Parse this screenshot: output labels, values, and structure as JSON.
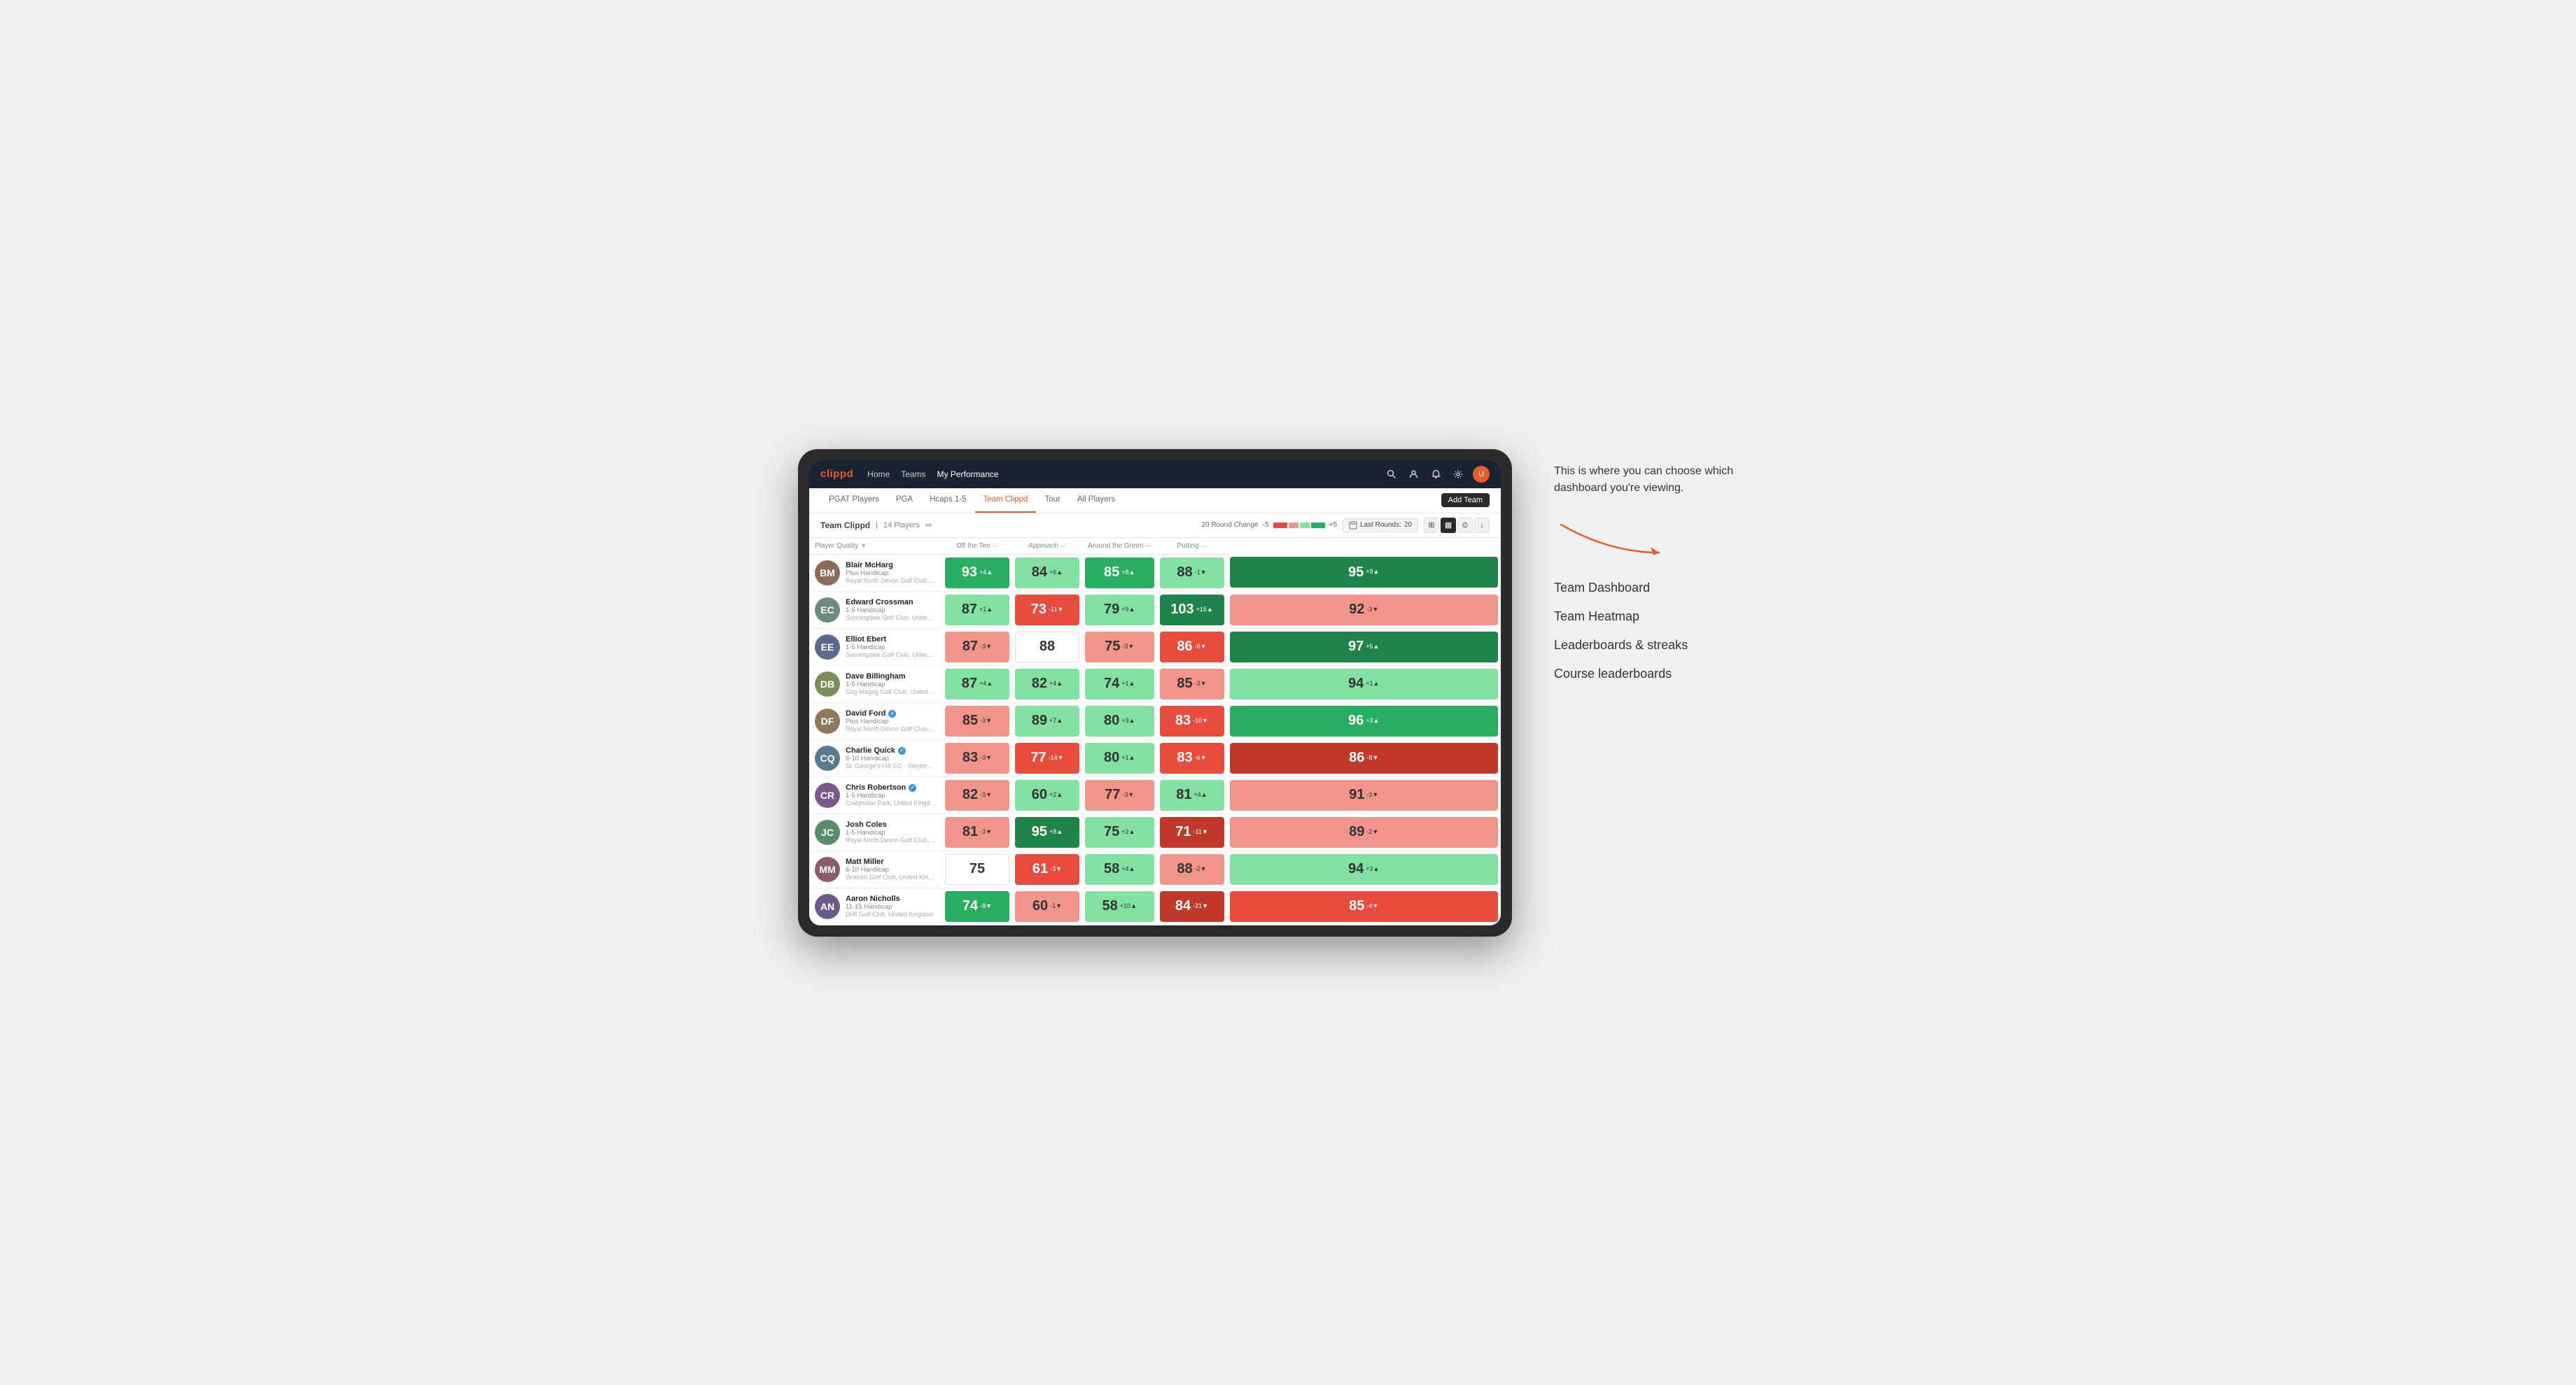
{
  "annotation": {
    "intro_text": "This is where you can choose which dashboard you're viewing.",
    "options": [
      {
        "label": "Team Dashboard"
      },
      {
        "label": "Team Heatmap"
      },
      {
        "label": "Leaderboards & streaks"
      },
      {
        "label": "Course leaderboards"
      }
    ]
  },
  "navbar": {
    "logo": "clippd",
    "links": [
      {
        "label": "Home",
        "active": false
      },
      {
        "label": "Teams",
        "active": false
      },
      {
        "label": "My Performance",
        "active": true
      }
    ],
    "icons": [
      "search",
      "user",
      "bell",
      "settings",
      "avatar"
    ]
  },
  "tabs": [
    {
      "label": "PGAT Players",
      "active": false
    },
    {
      "label": "PGA",
      "active": false
    },
    {
      "label": "Hcaps 1-5",
      "active": false
    },
    {
      "label": "Team Clippd",
      "active": true
    },
    {
      "label": "Tour",
      "active": false
    },
    {
      "label": "All Players",
      "active": false
    }
  ],
  "add_team_label": "Add Team",
  "sub_header": {
    "team_name": "Team Clippd",
    "player_count": "14 Players",
    "round_change_label": "20 Round Change",
    "change_min": "-5",
    "change_max": "+5",
    "last_rounds_label": "Last Rounds:",
    "last_rounds_value": "20"
  },
  "column_headers": [
    {
      "label": "Player Quality",
      "sortable": true,
      "key": "player_quality"
    },
    {
      "label": "Off the Tee",
      "sortable": true,
      "key": "off_tee"
    },
    {
      "label": "Approach",
      "sortable": true,
      "key": "approach"
    },
    {
      "label": "Around the Green",
      "sortable": true,
      "key": "around_green"
    },
    {
      "label": "Putting",
      "sortable": true,
      "key": "putting"
    }
  ],
  "players": [
    {
      "name": "Blair McHarg",
      "handicap": "Plus Handicap",
      "club": "Royal North Devon Golf Club, United Kingdom",
      "avatar_color": "#8e6a5a",
      "initials": "BM",
      "verified": false,
      "scores": [
        {
          "value": 93,
          "delta": "+4",
          "direction": "up",
          "color": "medium-green"
        },
        {
          "value": 84,
          "delta": "+6",
          "direction": "up",
          "color": "light-green"
        },
        {
          "value": 85,
          "delta": "+8",
          "direction": "up",
          "color": "medium-green"
        },
        {
          "value": 88,
          "delta": "-1",
          "direction": "down",
          "color": "light-green"
        },
        {
          "value": 95,
          "delta": "+9",
          "direction": "up",
          "color": "dark-green"
        }
      ]
    },
    {
      "name": "Edward Crossman",
      "handicap": "1-5 Handicap",
      "club": "Sunningdale Golf Club, United Kingdom",
      "avatar_color": "#6a8e7a",
      "initials": "EC",
      "verified": false,
      "scores": [
        {
          "value": 87,
          "delta": "+1",
          "direction": "up",
          "color": "light-green"
        },
        {
          "value": 73,
          "delta": "-11",
          "direction": "down",
          "color": "medium-red"
        },
        {
          "value": 79,
          "delta": "+9",
          "direction": "up",
          "color": "light-green"
        },
        {
          "value": 103,
          "delta": "+15",
          "direction": "up",
          "color": "dark-green"
        },
        {
          "value": 92,
          "delta": "-3",
          "direction": "down",
          "color": "light-red"
        }
      ]
    },
    {
      "name": "Elliot Ebert",
      "handicap": "1-5 Handicap",
      "club": "Sunningdale Golf Club, United Kingdom",
      "avatar_color": "#5a6a8e",
      "initials": "EE",
      "verified": false,
      "scores": [
        {
          "value": 87,
          "delta": "-3",
          "direction": "down",
          "color": "light-red"
        },
        {
          "value": 88,
          "delta": "",
          "direction": "none",
          "color": "white"
        },
        {
          "value": 75,
          "delta": "-3",
          "direction": "down",
          "color": "light-red"
        },
        {
          "value": 86,
          "delta": "-6",
          "direction": "down",
          "color": "medium-red"
        },
        {
          "value": 97,
          "delta": "+5",
          "direction": "up",
          "color": "dark-green"
        }
      ]
    },
    {
      "name": "Dave Billingham",
      "handicap": "1-5 Handicap",
      "club": "Gog Magog Golf Club, United Kingdom",
      "avatar_color": "#7a8e5a",
      "initials": "DB",
      "verified": false,
      "scores": [
        {
          "value": 87,
          "delta": "+4",
          "direction": "up",
          "color": "light-green"
        },
        {
          "value": 82,
          "delta": "+4",
          "direction": "up",
          "color": "light-green"
        },
        {
          "value": 74,
          "delta": "+1",
          "direction": "up",
          "color": "light-green"
        },
        {
          "value": 85,
          "delta": "-3",
          "direction": "down",
          "color": "light-red"
        },
        {
          "value": 94,
          "delta": "+1",
          "direction": "up",
          "color": "light-green"
        }
      ]
    },
    {
      "name": "David Ford",
      "handicap": "Plus Handicap",
      "club": "Royal North Devon Golf Club, United Kingdom",
      "avatar_color": "#8e7a5a",
      "initials": "DF",
      "verified": true,
      "scores": [
        {
          "value": 85,
          "delta": "-3",
          "direction": "down",
          "color": "light-red"
        },
        {
          "value": 89,
          "delta": "+7",
          "direction": "up",
          "color": "light-green"
        },
        {
          "value": 80,
          "delta": "+3",
          "direction": "up",
          "color": "light-green"
        },
        {
          "value": 83,
          "delta": "-10",
          "direction": "down",
          "color": "medium-red"
        },
        {
          "value": 96,
          "delta": "+3",
          "direction": "up",
          "color": "medium-green"
        }
      ]
    },
    {
      "name": "Charlie Quick",
      "handicap": "6-10 Handicap",
      "club": "St. George's Hill GC - Weybridge - Surrey, Uni...",
      "avatar_color": "#5a7a8e",
      "initials": "CQ",
      "verified": true,
      "scores": [
        {
          "value": 83,
          "delta": "-3",
          "direction": "down",
          "color": "light-red"
        },
        {
          "value": 77,
          "delta": "-14",
          "direction": "down",
          "color": "medium-red"
        },
        {
          "value": 80,
          "delta": "+1",
          "direction": "up",
          "color": "light-green"
        },
        {
          "value": 83,
          "delta": "-6",
          "direction": "down",
          "color": "medium-red"
        },
        {
          "value": 86,
          "delta": "-8",
          "direction": "down",
          "color": "dark-red"
        }
      ]
    },
    {
      "name": "Chris Robertson",
      "handicap": "1-5 Handicap",
      "club": "Craigmillar Park, United Kingdom",
      "avatar_color": "#7a5a8e",
      "initials": "CR",
      "verified": true,
      "scores": [
        {
          "value": 82,
          "delta": "-3",
          "direction": "down",
          "color": "light-red"
        },
        {
          "value": 60,
          "delta": "+2",
          "direction": "up",
          "color": "light-green"
        },
        {
          "value": 77,
          "delta": "-3",
          "direction": "down",
          "color": "light-red"
        },
        {
          "value": 81,
          "delta": "+4",
          "direction": "up",
          "color": "light-green"
        },
        {
          "value": 91,
          "delta": "-3",
          "direction": "down",
          "color": "light-red"
        }
      ]
    },
    {
      "name": "Josh Coles",
      "handicap": "1-5 Handicap",
      "club": "Royal North Devon Golf Club, United Kingdom",
      "avatar_color": "#5a8e6a",
      "initials": "JC",
      "verified": false,
      "scores": [
        {
          "value": 81,
          "delta": "-3",
          "direction": "down",
          "color": "light-red"
        },
        {
          "value": 95,
          "delta": "+8",
          "direction": "up",
          "color": "dark-green"
        },
        {
          "value": 75,
          "delta": "+2",
          "direction": "up",
          "color": "light-green"
        },
        {
          "value": 71,
          "delta": "-11",
          "direction": "down",
          "color": "dark-red"
        },
        {
          "value": 89,
          "delta": "-2",
          "direction": "down",
          "color": "light-red"
        }
      ]
    },
    {
      "name": "Matt Miller",
      "handicap": "6-10 Handicap",
      "club": "Woburn Golf Club, United Kingdom",
      "avatar_color": "#8e5a6a",
      "initials": "MM",
      "verified": false,
      "scores": [
        {
          "value": 75,
          "delta": "",
          "direction": "none",
          "color": "white"
        },
        {
          "value": 61,
          "delta": "-3",
          "direction": "down",
          "color": "medium-red"
        },
        {
          "value": 58,
          "delta": "+4",
          "direction": "up",
          "color": "light-green"
        },
        {
          "value": 88,
          "delta": "-2",
          "direction": "down",
          "color": "light-red"
        },
        {
          "value": 94,
          "delta": "+3",
          "direction": "up",
          "color": "light-green"
        }
      ]
    },
    {
      "name": "Aaron Nicholls",
      "handicap": "11-15 Handicap",
      "club": "Drift Golf Club, United Kingdom",
      "avatar_color": "#6a5a8e",
      "initials": "AN",
      "verified": false,
      "scores": [
        {
          "value": 74,
          "delta": "-8",
          "direction": "down",
          "color": "medium-green"
        },
        {
          "value": 60,
          "delta": "-1",
          "direction": "down",
          "color": "light-red"
        },
        {
          "value": 58,
          "delta": "+10",
          "direction": "up",
          "color": "light-green"
        },
        {
          "value": 84,
          "delta": "-21",
          "direction": "down",
          "color": "dark-red"
        },
        {
          "value": 85,
          "delta": "-4",
          "direction": "down",
          "color": "medium-red"
        }
      ]
    }
  ],
  "view_buttons": [
    {
      "icon": "grid",
      "active": false
    },
    {
      "icon": "heatmap",
      "active": true
    },
    {
      "icon": "list",
      "active": false
    },
    {
      "icon": "download",
      "active": false
    }
  ]
}
